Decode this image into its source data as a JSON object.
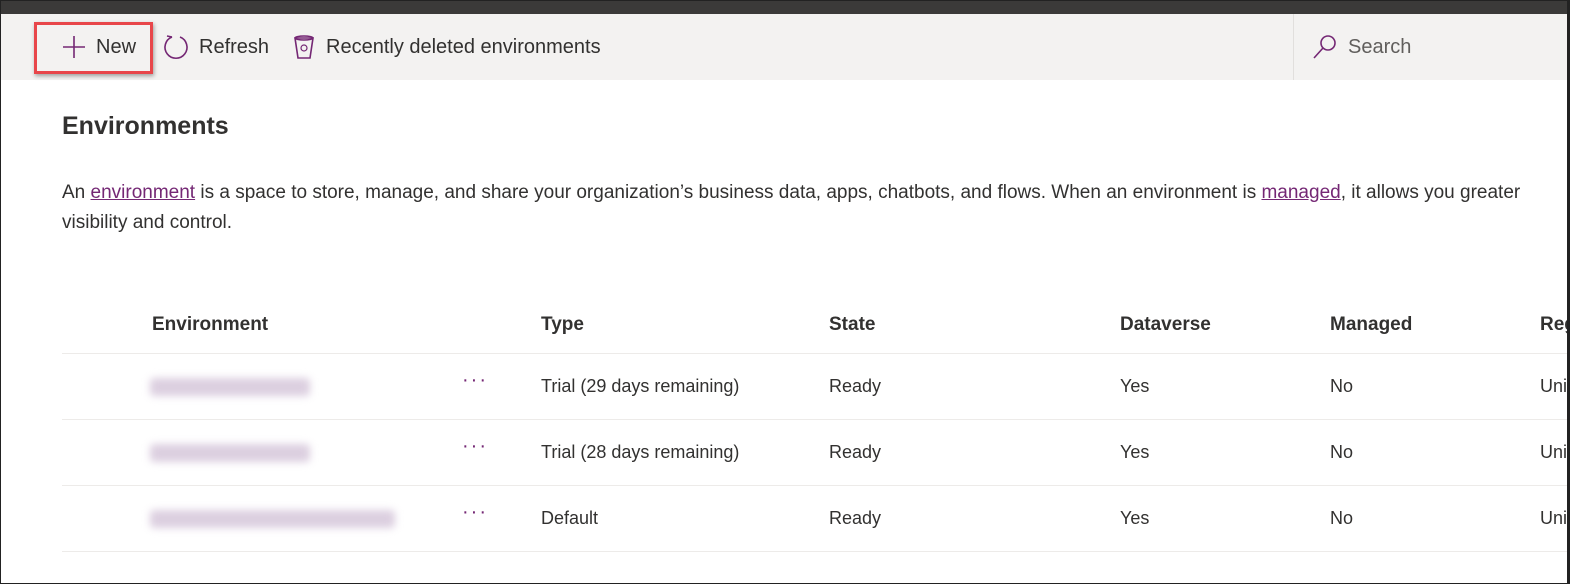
{
  "toolbar": {
    "new_label": "New",
    "refresh_label": "Refresh",
    "recently_deleted_label": "Recently deleted environments",
    "search_placeholder": "Search"
  },
  "page": {
    "title": "Environments",
    "desc_pre": "An ",
    "desc_link1": "environment",
    "desc_mid": " is a space to store, manage, and share your organization’s business data, apps, chatbots, and flows. When an environment is ",
    "desc_link2": "managed",
    "desc_post": ", it allows you greater visibility and control."
  },
  "table": {
    "columns": [
      "Environment",
      "Type",
      "State",
      "Dataverse",
      "Managed",
      "Region"
    ],
    "rows": [
      {
        "type": "Trial (29 days remaining)",
        "state": "Ready",
        "dataverse": "Yes",
        "managed": "No",
        "region": "United States"
      },
      {
        "type": "Trial (28 days remaining)",
        "state": "Ready",
        "dataverse": "Yes",
        "managed": "No",
        "region": "United States"
      },
      {
        "type": "Default",
        "state": "Ready",
        "dataverse": "Yes",
        "managed": "No",
        "region": "United States"
      }
    ],
    "more_label": "···"
  },
  "colors": {
    "accent": "#742774",
    "highlight": "#e8464a"
  }
}
